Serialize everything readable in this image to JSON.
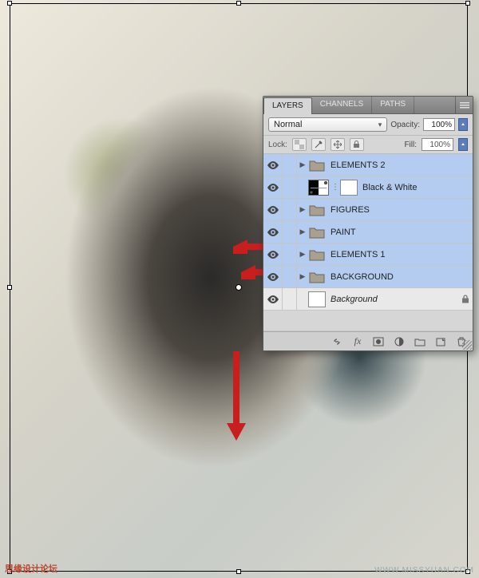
{
  "panel": {
    "tabs": [
      "LAYERS",
      "CHANNELS",
      "PATHS"
    ],
    "active_tab": 0,
    "blend_mode": "Normal",
    "opacity_label": "Opacity:",
    "opacity_value": "100%",
    "lock_label": "Lock:",
    "fill_label": "Fill:",
    "fill_value": "100%"
  },
  "layers": [
    {
      "name": "ELEMENTS 2",
      "type": "group",
      "selected": true,
      "visible": true
    },
    {
      "name": "Black & White",
      "type": "adjustment",
      "selected": true,
      "visible": true
    },
    {
      "name": "FIGURES",
      "type": "group",
      "selected": true,
      "visible": true
    },
    {
      "name": "PAINT",
      "type": "group",
      "selected": true,
      "visible": true
    },
    {
      "name": "ELEMENTS 1",
      "type": "group",
      "selected": true,
      "visible": true
    },
    {
      "name": "BACKGROUND",
      "type": "group",
      "selected": true,
      "visible": true
    },
    {
      "name": "Background",
      "type": "layer",
      "selected": false,
      "visible": true,
      "locked": true,
      "italic": true
    }
  ],
  "watermark": {
    "left": "思缘设计论坛",
    "right": "WWW.MISSYUAN.COM"
  }
}
